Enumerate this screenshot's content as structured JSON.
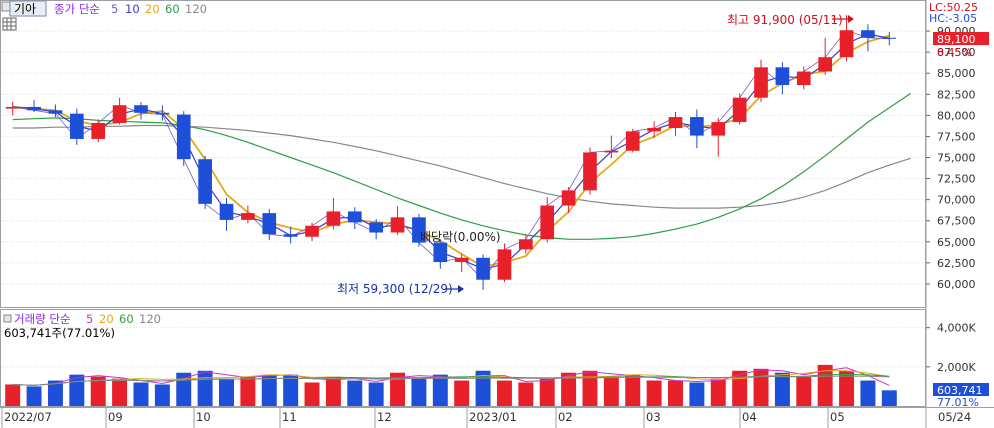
{
  "app": {
    "stock_name": "기아",
    "price_legend": {
      "label": "종가 단순",
      "periods": [
        "5",
        "10",
        "20",
        "60",
        "120"
      ]
    },
    "volume_legend": {
      "label": "거래량 단순",
      "periods": [
        "5",
        "20",
        "60",
        "120"
      ]
    },
    "volume_summary": "603,741주(77.01%)"
  },
  "colors": {
    "up": "#e8202a",
    "down": "#1d4fd8",
    "ma5": "#7a5cc0",
    "ma10": "#3a3ad0",
    "ma20": "#e6a817",
    "ma60": "#2e9e44",
    "ma120": "#888888"
  },
  "chart_data": [
    {
      "type": "candlestick",
      "title": "",
      "y_ticks": [
        "60,000",
        "62,500",
        "65,000",
        "67,500",
        "70,000",
        "72,500",
        "75,000",
        "77,500",
        "80,000",
        "82,500",
        "85,000",
        "87,500",
        "90,000"
      ],
      "ylim": [
        57500,
        92500
      ],
      "x_tick_labels": [
        "2022/07",
        "09",
        "10",
        "11",
        "12",
        "2023/01",
        "02",
        "03",
        "04",
        "05",
        "05/24"
      ],
      "ohlc_series_weekly_approx": [
        {
          "date": "2022/07",
          "o": 80800,
          "h": 81600,
          "l": 80000,
          "c": 81000
        },
        {
          "date": "2022/07",
          "o": 81000,
          "h": 81800,
          "l": 80400,
          "c": 80600
        },
        {
          "date": "2022/07",
          "o": 80600,
          "h": 81300,
          "l": 79800,
          "c": 80200
        },
        {
          "date": "2022/08",
          "o": 80200,
          "h": 80800,
          "l": 76500,
          "c": 77200
        },
        {
          "date": "2022/08",
          "o": 77200,
          "h": 79500,
          "l": 76800,
          "c": 79100
        },
        {
          "date": "2022/08",
          "o": 79100,
          "h": 82100,
          "l": 78900,
          "c": 81200
        },
        {
          "date": "2022/08",
          "o": 81200,
          "h": 81600,
          "l": 79500,
          "c": 80300
        },
        {
          "date": "2022/09",
          "o": 80300,
          "h": 81200,
          "l": 79400,
          "c": 80100
        },
        {
          "date": "2022/09",
          "o": 80100,
          "h": 80500,
          "l": 74000,
          "c": 74800
        },
        {
          "date": "2022/09",
          "o": 74800,
          "h": 75200,
          "l": 68900,
          "c": 69500
        },
        {
          "date": "2022/09",
          "o": 69500,
          "h": 70200,
          "l": 66300,
          "c": 67600
        },
        {
          "date": "2022/10",
          "o": 67600,
          "h": 69300,
          "l": 67200,
          "c": 68400
        },
        {
          "date": "2022/10",
          "o": 68400,
          "h": 68900,
          "l": 65200,
          "c": 65900
        },
        {
          "date": "2022/10",
          "o": 65900,
          "h": 66800,
          "l": 64800,
          "c": 65600
        },
        {
          "date": "2022/10",
          "o": 65600,
          "h": 67300,
          "l": 65100,
          "c": 66900
        },
        {
          "date": "2022/11",
          "o": 66900,
          "h": 70200,
          "l": 66500,
          "c": 68600
        },
        {
          "date": "2022/11",
          "o": 68600,
          "h": 69100,
          "l": 66500,
          "c": 67300
        },
        {
          "date": "2022/11",
          "o": 67300,
          "h": 67700,
          "l": 65300,
          "c": 66100
        },
        {
          "date": "2022/11",
          "o": 66100,
          "h": 69200,
          "l": 65800,
          "c": 67900
        },
        {
          "date": "2022/12",
          "o": 67900,
          "h": 68300,
          "l": 64400,
          "c": 64900
        },
        {
          "date": "2022/12",
          "o": 64900,
          "h": 65300,
          "l": 61800,
          "c": 62600
        },
        {
          "date": "2022/12",
          "o": 62600,
          "h": 63600,
          "l": 61400,
          "c": 63100
        },
        {
          "date": "2022/12",
          "o": 63100,
          "h": 63500,
          "l": 59300,
          "c": 60500
        },
        {
          "date": "2023/01",
          "o": 60500,
          "h": 64800,
          "l": 60200,
          "c": 64100
        },
        {
          "date": "2023/01",
          "o": 64100,
          "h": 65900,
          "l": 63600,
          "c": 65300
        },
        {
          "date": "2023/01",
          "o": 65300,
          "h": 70300,
          "l": 64900,
          "c": 69300
        },
        {
          "date": "2023/01",
          "o": 69300,
          "h": 71500,
          "l": 68400,
          "c": 71100
        },
        {
          "date": "2023/02",
          "o": 71100,
          "h": 76200,
          "l": 70600,
          "c": 75600
        },
        {
          "date": "2023/02",
          "o": 75600,
          "h": 77600,
          "l": 74900,
          "c": 75800
        },
        {
          "date": "2023/02",
          "o": 75800,
          "h": 78400,
          "l": 75600,
          "c": 78100
        },
        {
          "date": "2023/02",
          "o": 78100,
          "h": 79300,
          "l": 77300,
          "c": 78500
        },
        {
          "date": "2023/03",
          "o": 78500,
          "h": 80400,
          "l": 77600,
          "c": 79800
        },
        {
          "date": "2023/03",
          "o": 79800,
          "h": 80700,
          "l": 76100,
          "c": 77600
        },
        {
          "date": "2023/03",
          "o": 77600,
          "h": 79700,
          "l": 75100,
          "c": 79200
        },
        {
          "date": "2023/03",
          "o": 79200,
          "h": 82600,
          "l": 78900,
          "c": 82100
        },
        {
          "date": "2023/04",
          "o": 82100,
          "h": 86600,
          "l": 81600,
          "c": 85700
        },
        {
          "date": "2023/04",
          "o": 85700,
          "h": 86300,
          "l": 82500,
          "c": 83600
        },
        {
          "date": "2023/04",
          "o": 83600,
          "h": 85800,
          "l": 83100,
          "c": 85200
        },
        {
          "date": "2023/04",
          "o": 85200,
          "h": 89200,
          "l": 84800,
          "c": 86900
        },
        {
          "date": "2023/05",
          "o": 86900,
          "h": 91900,
          "l": 86400,
          "c": 90100
        },
        {
          "date": "2023/05",
          "o": 90100,
          "h": 90800,
          "l": 87600,
          "c": 89200
        },
        {
          "date": "2023/05",
          "o": 89200,
          "h": 89900,
          "l": 88300,
          "c": 89100
        }
      ],
      "moving_average_periods": [
        5,
        10,
        20,
        60,
        120
      ],
      "ma60_approx": [
        79500,
        79600,
        79700,
        79600,
        79400,
        79300,
        79200,
        79100,
        78800,
        78300,
        77600,
        76800,
        75900,
        75000,
        74100,
        73200,
        72200,
        71200,
        70200,
        69300,
        68400,
        67600,
        66900,
        66300,
        65800,
        65500,
        65300,
        65300,
        65400,
        65600,
        66000,
        66500,
        67100,
        67900,
        68900,
        70100,
        71600,
        73300,
        75200,
        77200,
        79200,
        80900,
        82600
      ],
      "ma120_approx": [
        78500,
        78500,
        78600,
        78600,
        78700,
        78700,
        78800,
        78800,
        78700,
        78600,
        78400,
        78200,
        77900,
        77600,
        77200,
        76800,
        76300,
        75800,
        75200,
        74600,
        74000,
        73300,
        72600,
        71900,
        71300,
        70700,
        70200,
        69800,
        69500,
        69300,
        69100,
        69000,
        69000,
        69000,
        69100,
        69300,
        69700,
        70300,
        71100,
        72100,
        73200,
        74100,
        74900
      ],
      "annotations": [
        {
          "text": "최고 91,900 (05/11)",
          "price": 91900,
          "date": "2023/05/11"
        },
        {
          "text": "최저 59,300 (12/29)",
          "price": 59300,
          "date": "2022/12/29"
        },
        {
          "text": "배당락(0.00%)",
          "date": "2022/12/28"
        }
      ],
      "right_labels": {
        "lc": "LC:50.25",
        "hc": "HC:-3.05",
        "current_price": "89,100",
        "change_pct": "0.45%"
      }
    },
    {
      "type": "bar",
      "title": "",
      "series_name": "거래량",
      "y_ticks": [
        "2,000K",
        "4,000K"
      ],
      "ylim": [
        0,
        4800000
      ],
      "volume_approx": [
        1100000,
        1000000,
        1300000,
        1600000,
        1500000,
        1400000,
        1200000,
        1100000,
        1700000,
        1800000,
        1400000,
        1500000,
        1600000,
        1600000,
        1200000,
        1500000,
        1300000,
        1200000,
        1700000,
        1400000,
        1600000,
        1300000,
        1800000,
        1300000,
        1200000,
        1400000,
        1700000,
        1800000,
        1500000,
        1600000,
        1300000,
        1300000,
        1200000,
        1400000,
        1800000,
        1900000,
        1700000,
        1500000,
        2100000,
        1800000,
        1300000,
        800000
      ],
      "right_labels": {
        "current": "603,741",
        "pct": "77.01%"
      }
    }
  ]
}
